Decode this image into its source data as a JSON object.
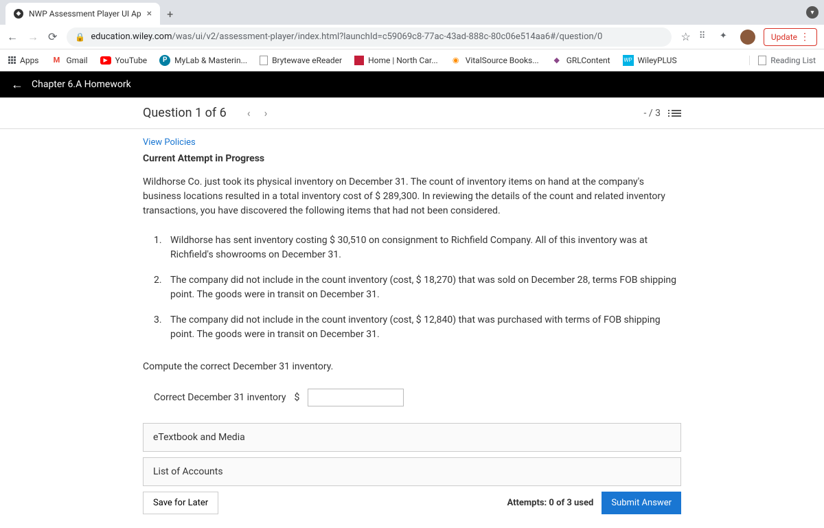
{
  "browser": {
    "tab_title": "NWP Assessment Player UI Ap",
    "url_host": "education.wiley.com",
    "url_path": "/was/ui/v2/assessment-player/index.html?launchId=c59069c8-77ac-43ad-888c-80c06e514aa6#/question/0",
    "update_label": "Update"
  },
  "bookmarks": {
    "apps": "Apps",
    "gmail": "Gmail",
    "youtube": "YouTube",
    "mylab": "MyLab & Masterin...",
    "brytewave": "Brytewave eReader",
    "northcar": "Home | North Car...",
    "vitalsource": "VitalSource Books...",
    "grl": "GRLContent",
    "wileyplus": "WileyPLUS",
    "reading_list": "Reading List"
  },
  "header": {
    "title": "Chapter 6.A Homework"
  },
  "question_bar": {
    "title": "Question 1 of 6",
    "score": "- / 3"
  },
  "content": {
    "policies": "View Policies",
    "attempt_status": "Current Attempt in Progress",
    "prompt": "Wildhorse Co. just took its physical inventory on December 31. The count of inventory items on hand at the company's business locations resulted in a total inventory cost of $ 289,300. In reviewing the details of the count and related inventory transactions, you have discovered the following items that had not been considered.",
    "items": [
      {
        "num": "1.",
        "text": "Wildhorse has sent inventory costing $ 30,510 on consignment to Richfield Company. All of this inventory was at Richfield's showrooms on December 31."
      },
      {
        "num": "2.",
        "text": "The company did not include in the count inventory (cost, $ 18,270) that was sold on December 28, terms FOB shipping point. The goods were in transit on December 31."
      },
      {
        "num": "3.",
        "text": "The company did not include in the count inventory (cost, $ 12,840) that was purchased with terms of FOB shipping point. The goods were in transit on December 31."
      }
    ],
    "compute": "Compute the correct December 31 inventory.",
    "answer_label": "Correct December 31 inventory",
    "currency": "$",
    "panel_textbook": "eTextbook and Media",
    "panel_accounts": "List of Accounts",
    "save_label": "Save for Later",
    "attempts": "Attempts: 0 of 3 used",
    "submit_label": "Submit Answer"
  }
}
